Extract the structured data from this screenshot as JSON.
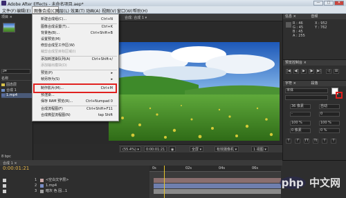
{
  "window": {
    "title": "Adobe After Effects - 未命名项目.aep*",
    "min": "—",
    "max": "□",
    "close": "✕"
  },
  "menubar": [
    "文件(F)",
    "编辑(E)",
    "图像合成(C)",
    "图层(L)",
    "效果(T)",
    "动画(A)",
    "视图(V)",
    "窗口(W)",
    "帮助(H)"
  ],
  "project": {
    "tab": "项目 ×",
    "search": "ρ▾",
    "rows": [
      {
        "label": "名称",
        "color": ""
      },
      {
        "label": "固态层",
        "color": "#d9c34b"
      },
      {
        "label": "合成 1",
        "color": "#6e8fc9"
      },
      {
        "label": "1.mp4",
        "color": "#5a6ea0"
      }
    ],
    "footer": "8 bpc"
  },
  "dropdown": {
    "items": [
      {
        "label": "新建合成组(C)...",
        "shortcut": "Ctrl+N",
        "disabled": false
      },
      {
        "label": "图像合成设置(T)...",
        "shortcut": "Ctrl+K",
        "disabled": false
      },
      {
        "label": "背景色(B)...",
        "shortcut": "Ctrl+Shift+B",
        "disabled": false
      },
      {
        "label": "设置预览(M)",
        "shortcut": "",
        "disabled": false
      },
      {
        "label": "修剪合成至工作区(W)",
        "shortcut": "",
        "disabled": false
      },
      {
        "label": "裁剪合成至目标区域(I)",
        "shortcut": "",
        "disabled": true
      },
      {
        "label": "添加到渲染队列(A)",
        "shortcut": "Ctrl+Shift+/",
        "disabled": false
      },
      {
        "label": "添加输出模块(D)",
        "shortcut": "",
        "disabled": true
      },
      {
        "label": "预览(P)",
        "shortcut": "▸",
        "disabled": false
      },
      {
        "label": "帧另存为(S)",
        "shortcut": "▸",
        "disabled": false
      },
      {
        "label": "制作影片(M)...",
        "shortcut": "Ctrl+M",
        "disabled": false
      },
      {
        "label": "预渲染...",
        "shortcut": "",
        "disabled": false
      },
      {
        "label": "保存 RAM 预览(R)...",
        "shortcut": "Ctrl+Numpad 0",
        "disabled": false
      },
      {
        "label": "合成流程图(F)",
        "shortcut": "Ctrl+Shift+F11",
        "disabled": false
      },
      {
        "label": "合成微型流程图(N)",
        "shortcut": "tap Shift",
        "disabled": false
      }
    ]
  },
  "viewer": {
    "tab": "合成: 合成 1 ▾",
    "lock": "🔒",
    "zoom": "(55.4%) ▾",
    "timecode": "0:00:01:21",
    "resolution": "全屏 ▾",
    "view": "有效摄像机 ▾",
    "views": "1 视图 ▾"
  },
  "info": {
    "tab": "信息 ×",
    "tab2": "音频",
    "lines": [
      "R : 46",
      "G : 45",
      "B : 45",
      "A : 255"
    ],
    "xy": [
      "X : 952",
      "Y : 762"
    ]
  },
  "preview": {
    "tab": "预览控制台 ×",
    "controls": [
      "|◀",
      "◀|",
      "▶",
      "|▶",
      "▶|",
      "◁",
      "⊞"
    ]
  },
  "character": {
    "tab": "字符 ×",
    "tab2": "段落",
    "font": "宋体",
    "style": "",
    "size": "36 像素",
    "leading": "自动",
    "tracking": "0",
    "stroke": "-",
    "scale_v": "100 %",
    "scale_h": "100 %",
    "baseline": "0 像素",
    "tsume": "0 %",
    "styles": [
      "T",
      "T",
      "TT",
      "Tt",
      "T",
      "T"
    ],
    "fill_color": "#ffffff",
    "stroke_color": "#e0201e"
  },
  "timeline": {
    "tab": "合成 1 ×",
    "timecode": "0:00:01:21",
    "ruler": [
      "0s",
      "02s",
      "04s",
      "06s"
    ],
    "layers": [
      {
        "num": "1",
        "name": "<空白文字层>",
        "color": "#c9a6a6"
      },
      {
        "num": "2",
        "name": "1.mp4",
        "color": "#7b8ec7"
      },
      {
        "num": "3",
        "name": "暗灰 色 固...1",
        "color": "#a0a0a0"
      }
    ]
  },
  "watermark": {
    "p": "php",
    "rest": " 中文网"
  }
}
